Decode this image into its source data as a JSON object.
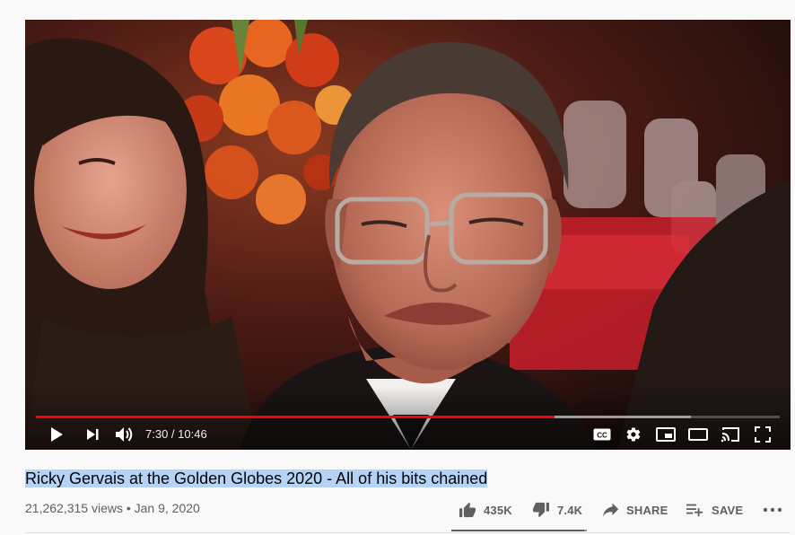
{
  "video": {
    "current_time": "7:30",
    "duration": "10:46",
    "time_display": "7:30 / 10:46",
    "played_fraction": 0.697,
    "buffered_fraction": 0.88,
    "accent_color": "#ff0000"
  },
  "controls": {
    "icons": [
      "play-icon",
      "next-icon",
      "volume-icon",
      "cc-icon",
      "settings-icon",
      "miniplayer-icon",
      "theater-icon",
      "cast-icon",
      "fullscreen-icon"
    ],
    "cc_label": "CC"
  },
  "info": {
    "title": "Ricky Gervais at the Golden Globes 2020 - All of his bits chained",
    "views": "21,262,315 views",
    "separator": "•",
    "date": "Jan 9, 2020",
    "meta_line": "21,262,315 views • Jan 9, 2020"
  },
  "actions": {
    "like_count": "435K",
    "dislike_count": "7.4K",
    "share_label": "SHARE",
    "save_label": "SAVE",
    "like_fraction": 0.983
  }
}
